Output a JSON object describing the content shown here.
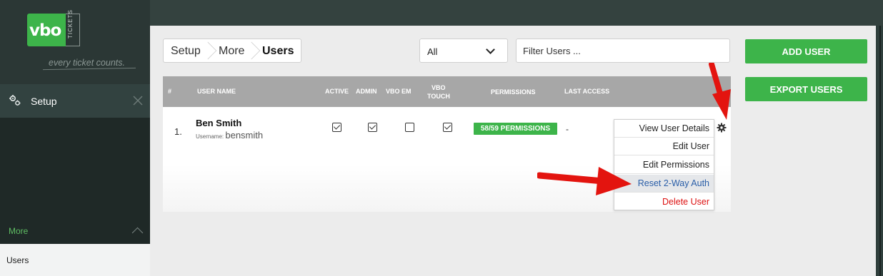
{
  "brand": {
    "logo_text": "vbo",
    "logo_side_text": "TICKETS",
    "tagline": "every ticket counts.",
    "accent_color": "#3db44a"
  },
  "sidebar": {
    "setup_label": "Setup",
    "setup_icon": "gears-icon",
    "more_label": "More",
    "active_item_label": "Users"
  },
  "breadcrumb": [
    "Setup",
    "More",
    "Users"
  ],
  "filters": {
    "scope_selected": "All",
    "search_placeholder": "Filter Users ..."
  },
  "actions": {
    "add_user": "ADD USER",
    "export_users": "EXPORT USERS"
  },
  "table": {
    "columns": {
      "num": "#",
      "user_name": "USER NAME",
      "active": "ACTIVE",
      "admin": "ADMIN",
      "vbo_em": "VBO EM",
      "vbo_touch_1": "VBO",
      "vbo_touch_2": "TOUCH",
      "permissions": "PERMISSIONS",
      "last_access": "LAST ACCESS"
    },
    "rows": [
      {
        "num": "1.",
        "name": "Ben Smith",
        "username_label": "Username:",
        "username": "bensmith",
        "active": true,
        "admin": true,
        "vbo_em": false,
        "vbo_touch": true,
        "permissions": "58/59 PERMISSIONS",
        "last_access": "-"
      }
    ]
  },
  "row_menu": {
    "items": [
      "View User Details",
      "Edit User",
      "Edit Permissions",
      "Reset 2-Way Auth",
      "Delete User"
    ],
    "highlighted": "Reset 2-Way Auth",
    "danger_color": "#dd1111",
    "highlight_color": "#2a5ea8"
  },
  "annotations": {
    "arrow_color": "#e3140f"
  }
}
